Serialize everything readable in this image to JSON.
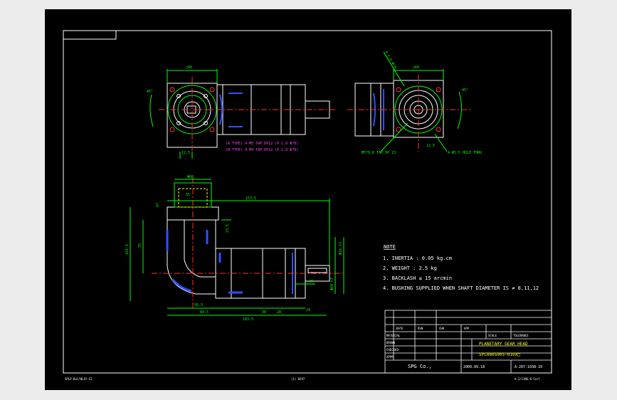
{
  "colors": {
    "background": "#000000",
    "frame": "#ffffff",
    "outline": "#ffffff",
    "dimension": "#00ff00",
    "centerline": "#ff3030",
    "hidden": "#ffff00",
    "bore": "#3050ff",
    "thread_note": "#ff40ff",
    "page_bg": "#ececec"
  },
  "top_left_view": {
    "dim_top": "□60",
    "dim_bottom": "12.5",
    "dim_side": "45°"
  },
  "top_right_view": {
    "dim_top": "□60",
    "dim_angle": "45°",
    "dim_pcd": "P.C.D Φ70",
    "dim_bottom": "12.5",
    "note_tap": "M5*0.8 TAP DP 13",
    "note_hole": "4-Φ5.5 HOLE THRU"
  },
  "notes_tap": [
    "(A TYPE) 4-M5 TAP DP12 (P.C.D Φ70)",
    "(B TYPE) 4-M4 TAP DP12 (P.C.D Φ70)"
  ],
  "main_view": {
    "dim_overall_length": "153.5",
    "dim_height_total": "181.5",
    "dim_height_partial": "75",
    "dim_sub_1": "47",
    "dim_sub_2": "55",
    "dim_bottom_1": "56.5",
    "dim_bottom_2": "84.5",
    "dim_bottom_3": "30",
    "dim_bottom_4": "20",
    "dim_bottom_5": "183.5",
    "dim_shaft_1": "Φ60 h7",
    "dim_shaft_2": "Φ16 h7",
    "dim_right_1": "25",
    "dim_right_2": "24",
    "dim_key": "23.5",
    "dim_top_small": "Φ60"
  },
  "note": {
    "title": "NOTE",
    "items": [
      "1. INERTIA : 0.05 kg.cm",
      "2. WEIGHT : 2.5 kg",
      "3. BACKLASH ≤ 15 arcmin",
      "4. BUSHING SUPPLIED WHEN SHAFT DIAMETER IS ≠ 8,11,12"
    ]
  },
  "title_block": {
    "rev_labels": [
      "DATE",
      "DSN",
      "CHK",
      "APP"
    ],
    "material_label": "MATERIAL",
    "scale_label": "SCALE",
    "tolerance_label": "TOLERANCE",
    "drawn_label": "DRAWN",
    "checked_label": "CHECKED",
    "approved_label": "APPR",
    "title_line1": "PLANETARY GEAR HEAD",
    "title_line2": "SPL060S005~010X□",
    "company": "SPG Co.,",
    "date": "2009.09.18",
    "drawing_no": "A-207-1038-10"
  },
  "status_left": "SPLP-Dwl/WLSY-SI",
  "status_mid": "(1) 0297",
  "status_right": "A-2/1ING-6-Corl"
}
